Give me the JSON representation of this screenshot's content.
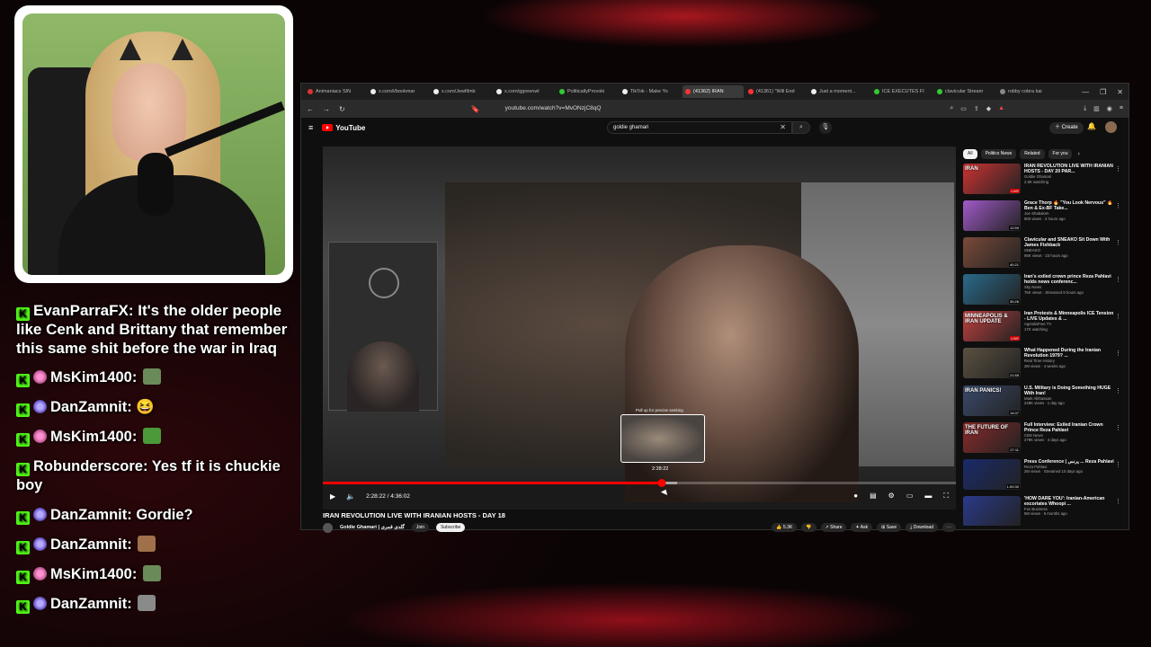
{
  "chat": [
    {
      "user": "EvanParraFX",
      "text": "It's the older people like Cenk and Brittany that remember this same shit before the war in Iraq",
      "badge": "none",
      "emote": ""
    },
    {
      "user": "MsKim1400",
      "text": "",
      "badge": "pink",
      "emote": "gun-emote"
    },
    {
      "user": "DanZamnit",
      "text": "😆",
      "badge": "blue",
      "emote": ""
    },
    {
      "user": "MsKim1400",
      "text": "",
      "badge": "pink",
      "emote": "frog-emote"
    },
    {
      "user": "Robunderscore",
      "text": "Yes tf it is chuckie boy",
      "badge": "none",
      "emote": ""
    },
    {
      "user": "DanZamnit",
      "text": "Gordie?",
      "badge": "blue",
      "emote": ""
    },
    {
      "user": "DanZamnit",
      "text": "",
      "badge": "blue",
      "emote": "dog-emote"
    },
    {
      "user": "MsKim1400",
      "text": "",
      "badge": "pink",
      "emote": "gun-emote"
    },
    {
      "user": "DanZamnit",
      "text": "",
      "badge": "blue",
      "emote": "cat-emote"
    }
  ],
  "browser": {
    "tabs": [
      {
        "label": "Animaniacs SIN",
        "color": "#d33"
      },
      {
        "label": "x.com/i/bookmar",
        "color": "#eee"
      },
      {
        "label": "x.com/Jewfilmb",
        "color": "#eee"
      },
      {
        "label": "x.com/ggreenwl",
        "color": "#eee"
      },
      {
        "label": "PoliticallyProvoki",
        "color": "#3c3"
      },
      {
        "label": "TikTok - Make Yo",
        "color": "#eee"
      },
      {
        "label": "(41362) IRAN",
        "color": "#f33"
      },
      {
        "label": "(41361) \"Will End",
        "color": "#f33"
      },
      {
        "label": "Just a moment...",
        "color": "#eee"
      },
      {
        "label": "ICE EXECUTES FI",
        "color": "#3c3"
      },
      {
        "label": "clavicular Stream",
        "color": "#3c3"
      },
      {
        "label": "robby cobra kai",
        "color": "#888"
      }
    ],
    "url": "youtube.com/watch?v=MvONzjC8qQ"
  },
  "youtube": {
    "logo": "YouTube",
    "search_value": "goldie ghamari",
    "create_label": "Create",
    "preview_label": "Pull up for precise seeking",
    "preview_time": "2:28:22",
    "time_display": "2:28:22 / 4:36:02",
    "progress_fraction": 0.536,
    "buffer_fraction": 0.56,
    "title": "IRAN REVOLUTION LIVE WITH IRANIAN HOSTS - DAY 18",
    "channel": "Goldie Ghamari | گلدی قمری",
    "join_label": "Join",
    "subscribe_label": "Subscribe",
    "actions": [
      "5.3K",
      "Share",
      "Ask",
      "Save",
      "Download"
    ],
    "chips": [
      "All",
      "Politics News",
      "Related",
      "For you"
    ],
    "recs": [
      {
        "title": "IRAN REVOLUTION LIVE WITH IRANIAN HOSTS - DAY 20 PAR...",
        "channel": "Goldie Ghamari",
        "meta": "2.5K watching",
        "badge": "LIVE",
        "thumb_color": "#c33",
        "thumb_text": "IRAN"
      },
      {
        "title": "Grace Thorp 🔥 \"You Look Nervous\" 🔥 Ben & Ex-BF Take...",
        "channel": "Joe Shabalom",
        "meta": "900 views · 2 hours ago",
        "badge": "12:59",
        "thumb_color": "#a05ac8",
        "thumb_text": ""
      },
      {
        "title": "Clavicular and SNEAKO Sit Down With James Fishback",
        "channel": "SNEAKO",
        "meta": "95K views · 23 hours ago",
        "badge": "40:21",
        "thumb_color": "#7a4a3a",
        "thumb_text": ""
      },
      {
        "title": "Iran's exiled crown prince Reza Pahlavi holds news conferenc...",
        "channel": "Sky News",
        "meta": "75K views · Streamed 9 hours ago",
        "badge": "30:26",
        "thumb_color": "#2a6a8a",
        "thumb_text": ""
      },
      {
        "title": "Iran Protests & Minneapolis ICE Tension - LIVE Updates & ...",
        "channel": "AgendaFree TV",
        "meta": "17K watching",
        "badge": "LIVE",
        "thumb_color": "#c04040",
        "thumb_text": "MINNEAPOLIS & IRAN UPDATE"
      },
      {
        "title": "What Happened During the Iranian Revolution 1979? ...",
        "channel": "Real Time History",
        "meta": "2M views · 4 weeks ago",
        "badge": "21:55",
        "thumb_color": "#5a5040",
        "thumb_text": ""
      },
      {
        "title": "U.S. Military is Doing Something HUGE With Iran!",
        "channel": "Mark Alkhassan",
        "meta": "248K views · 1 day ago",
        "badge": "14:07",
        "thumb_color": "#3a4a6a",
        "thumb_text": "IRAN PANICS!"
      },
      {
        "title": "Full Interview: Exiled Iranian Crown Prince Reza Pahlavi",
        "channel": "CBS News",
        "meta": "279K views · 4 days ago",
        "badge": "27:11",
        "thumb_color": "#8a2a2a",
        "thumb_text": "THE FUTURE OF IRAN"
      },
      {
        "title": "Press Conference | پرنس ... Reza Pahlavi",
        "channel": "Reza Pahlavi",
        "meta": "2M views · Streamed 10 days ago",
        "badge": "1:00:30",
        "thumb_color": "#1a2a6a",
        "thumb_text": ""
      },
      {
        "title": "'HOW DARE YOU': Iranian-American excoriates Whoopi ...",
        "channel": "Fox Business",
        "meta": "5M views · 6 months ago",
        "badge": "",
        "thumb_color": "#2a3a8a",
        "thumb_text": ""
      }
    ]
  }
}
